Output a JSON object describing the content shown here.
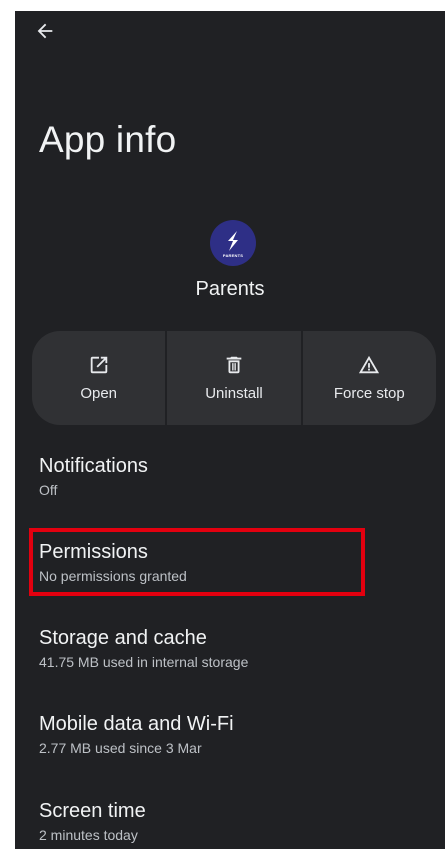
{
  "header": {
    "title": "App info"
  },
  "app": {
    "name": "Parents",
    "icon_text": "PARENTS",
    "icon_color": "#2e2f86"
  },
  "actions": [
    {
      "label": "Open",
      "icon": "open-external-icon"
    },
    {
      "label": "Uninstall",
      "icon": "trash-icon"
    },
    {
      "label": "Force stop",
      "icon": "warning-icon"
    }
  ],
  "settings": [
    {
      "title": "Notifications",
      "subtitle": "Off"
    },
    {
      "title": "Permissions",
      "subtitle": "No permissions granted"
    },
    {
      "title": "Storage and cache",
      "subtitle": "41.75 MB used in internal storage"
    },
    {
      "title": "Mobile data and Wi-Fi",
      "subtitle": "2.77 MB used since 3 Mar"
    },
    {
      "title": "Screen time",
      "subtitle": "2 minutes today"
    }
  ],
  "annotation": {
    "highlight_color": "#e3000f",
    "highlighted_item": "Permissions"
  },
  "colors": {
    "background": "#202124",
    "button_bg": "#303134",
    "text_primary": "#f1f3f4",
    "text_secondary": "#bdc1c6"
  }
}
